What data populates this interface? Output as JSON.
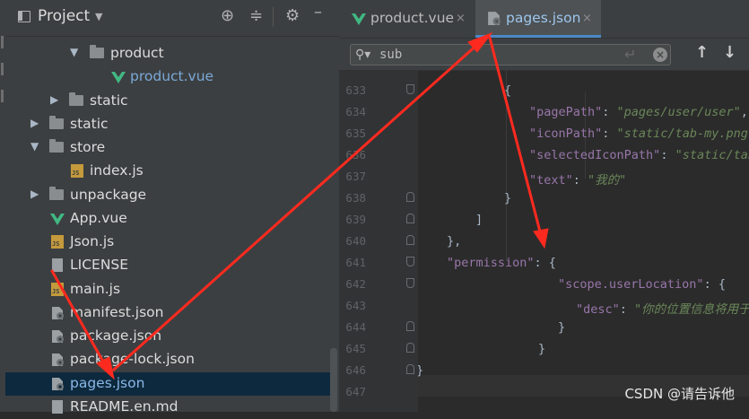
{
  "project_panel": {
    "title": "Project",
    "tree": [
      {
        "label": "product",
        "kind": "folder",
        "expanded": true
      },
      {
        "label": "product.vue",
        "kind": "vue"
      },
      {
        "label": "static",
        "kind": "folder",
        "expanded": false
      },
      {
        "label": "static",
        "kind": "folder",
        "expanded": false
      },
      {
        "label": "store",
        "kind": "folder",
        "expanded": true
      },
      {
        "label": "index.js",
        "kind": "js"
      },
      {
        "label": "unpackage",
        "kind": "folder",
        "expanded": false
      },
      {
        "label": "App.vue",
        "kind": "vue"
      },
      {
        "label": "Json.js",
        "kind": "js"
      },
      {
        "label": "LICENSE",
        "kind": "file"
      },
      {
        "label": "main.js",
        "kind": "js"
      },
      {
        "label": "manifest.json",
        "kind": "json"
      },
      {
        "label": "package.json",
        "kind": "json"
      },
      {
        "label": "package-lock.json",
        "kind": "json"
      },
      {
        "label": "pages.json",
        "kind": "json",
        "selected": true
      },
      {
        "label": "README.en.md",
        "kind": "file"
      }
    ],
    "icons": {
      "settings": "gear-icon",
      "collapse": "collapse-all-icon",
      "locate": "locate-icon",
      "minimize": "minimize-icon"
    }
  },
  "editor": {
    "tabs": [
      {
        "label": "product.vue",
        "close": "×",
        "active": false
      },
      {
        "label": "pages.json",
        "close": "×",
        "active": true
      }
    ],
    "search": {
      "value": "sub",
      "up": "↑",
      "down": "↓"
    },
    "line_numbers": [
      "633",
      "634",
      "635",
      "636",
      "637",
      "638",
      "639",
      "640",
      "641",
      "642",
      "643",
      "644",
      "645",
      "646",
      "647"
    ],
    "lines": [
      {
        "parts": [
          {
            "t": "{",
            "c": "p"
          }
        ]
      },
      {
        "parts": [
          {
            "t": "\"pagePath\"",
            "c": "k"
          },
          {
            "t": ": ",
            "c": "p"
          },
          {
            "t": "\"pages/user/user\"",
            "c": "s"
          },
          {
            "t": ",",
            "c": "p"
          }
        ]
      },
      {
        "parts": [
          {
            "t": "\"iconPath\"",
            "c": "k"
          },
          {
            "t": ": ",
            "c": "p"
          },
          {
            "t": "\"static/tab-my.png\"",
            "c": "s"
          }
        ]
      },
      {
        "parts": [
          {
            "t": "\"selectedIconPath\"",
            "c": "k"
          },
          {
            "t": ": ",
            "c": "p"
          },
          {
            "t": "\"static/tab",
            "c": "s"
          }
        ]
      },
      {
        "parts": [
          {
            "t": "\"text\"",
            "c": "k"
          },
          {
            "t": ": ",
            "c": "p"
          },
          {
            "t": "\"我的\"",
            "c": "s"
          }
        ]
      },
      {
        "parts": [
          {
            "t": "}",
            "c": "p"
          }
        ]
      },
      {
        "parts": [
          {
            "t": "]",
            "c": "p"
          }
        ]
      },
      {
        "parts": [
          {
            "t": "},",
            "c": "p"
          }
        ]
      },
      {
        "parts": [
          {
            "t": "\"permission\"",
            "c": "k"
          },
          {
            "t": ": {",
            "c": "p"
          }
        ]
      },
      {
        "parts": [
          {
            "t": "\"scope.userLocation\"",
            "c": "k"
          },
          {
            "t": ": {",
            "c": "p"
          }
        ]
      },
      {
        "parts": [
          {
            "t": "\"desc\"",
            "c": "k"
          },
          {
            "t": ": ",
            "c": "p"
          },
          {
            "t": "\"你的位置信息将用于",
            "c": "s"
          }
        ]
      },
      {
        "parts": [
          {
            "t": "}",
            "c": "p"
          }
        ]
      },
      {
        "parts": [
          {
            "t": "}",
            "c": "p"
          }
        ]
      },
      {
        "parts": [
          {
            "t": "}",
            "c": "p"
          }
        ]
      },
      {
        "parts": []
      }
    ]
  },
  "watermark": "CSDN @请告诉他",
  "colors": {
    "annotation_arrow": "#ff2a1f",
    "accent": "#4a88c7",
    "key": "#9876aa",
    "string": "#6a8759"
  }
}
